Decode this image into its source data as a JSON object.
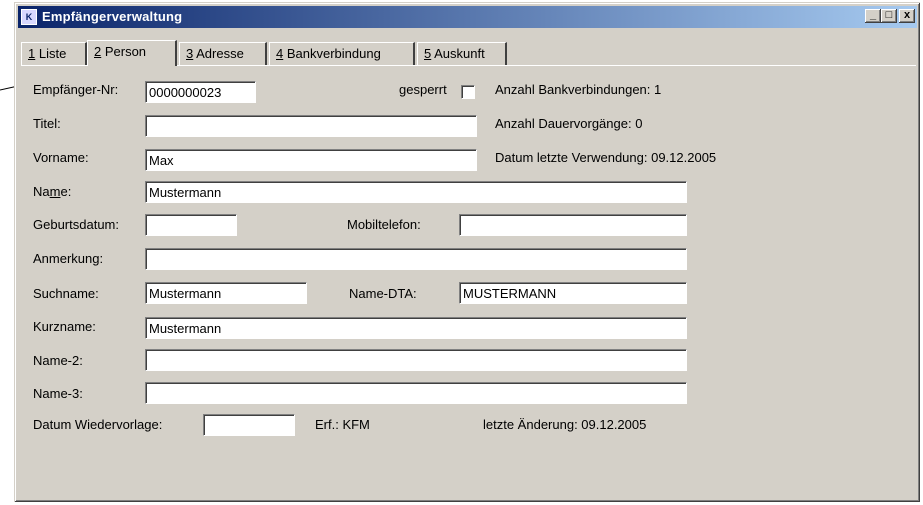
{
  "window": {
    "title": "Empfängerverwaltung",
    "icon": "app-icon"
  },
  "titlebar_buttons": {
    "minimize": "_",
    "maximize": "□",
    "close": "x"
  },
  "tabs": [
    {
      "key": "1",
      "label": " Liste"
    },
    {
      "key": "2",
      "label": " Person"
    },
    {
      "key": "3",
      "label": " Adresse"
    },
    {
      "key": "4",
      "label": " Bankverbindung"
    },
    {
      "key": "5",
      "label": " Auskunft"
    }
  ],
  "form": {
    "empfaenger_nr_label": "Empfänger-Nr:",
    "empfaenger_nr_value": "0000000023",
    "gesperrt_label": "gesperrt",
    "gesperrt_checked": false,
    "anzahl_bank": "Anzahl Bankverbindungen: 1",
    "titel_label": "Titel:",
    "titel_value": "",
    "anzahl_dauer": "Anzahl Dauervorgänge: 0",
    "vorname_label": "Vorname:",
    "vorname_value": "Max",
    "datum_letzte": "Datum letzte Verwendung: 09.12.2005",
    "name_label_pre": "Na",
    "name_label_u": "m",
    "name_label_post": "e:",
    "name_value": "Mustermann",
    "geburtsdatum_label": "Geburtsdatum:",
    "geburtsdatum_value": "",
    "mobiltelefon_label": "Mobiltelefon:",
    "mobiltelefon_value": "",
    "anmerkung_label": "Anmerkung:",
    "anmerkung_value": "",
    "suchname_label": "Suchname:",
    "suchname_value": "Mustermann",
    "name_dta_label": "Name-DTA:",
    "name_dta_value": "MUSTERMANN",
    "kurzname_label": "Kurzname:",
    "kurzname_value": "Mustermann",
    "name2_label": "Name-2:",
    "name2_value": "",
    "name3_label": "Name-3:",
    "name3_value": "",
    "datum_wiedervorlage_label": "Datum Wiedervorlage:",
    "datum_wiedervorlage_value": "",
    "erf_text": "Erf.: KFM",
    "letzte_aenderung": "letzte Änderung: 09.12.2005"
  }
}
